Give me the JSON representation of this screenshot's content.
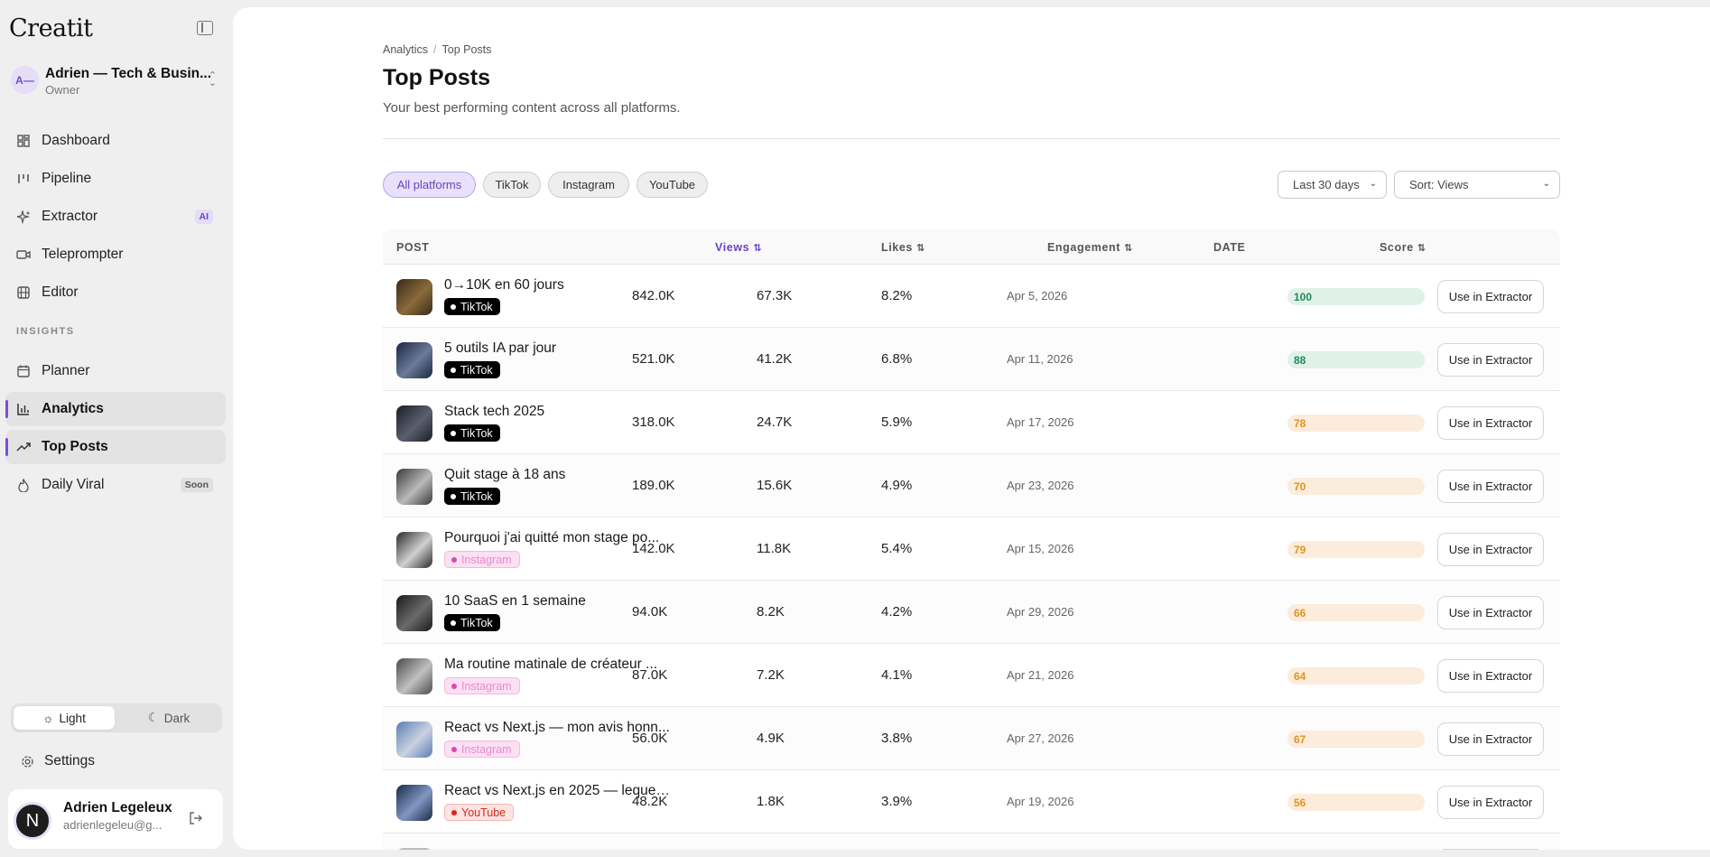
{
  "app": {
    "logo": "Creatit",
    "workspace": {
      "avatar": "A—",
      "name": "Adrien — Tech & Busin...",
      "role": "Owner"
    }
  },
  "nav": {
    "items": [
      {
        "label": "Dashboard",
        "icon": "grid-icon"
      },
      {
        "label": "Pipeline",
        "icon": "kanban-icon"
      },
      {
        "label": "Extractor",
        "icon": "sparkles-icon",
        "badge": "AI"
      },
      {
        "label": "Teleprompter",
        "icon": "video-icon"
      },
      {
        "label": "Editor",
        "icon": "film-icon"
      }
    ],
    "section_label": "INSIGHTS",
    "insights": [
      {
        "label": "Planner",
        "icon": "calendar-icon"
      },
      {
        "label": "Analytics",
        "icon": "bar-chart-icon",
        "active": true
      },
      {
        "label": "Top Posts",
        "icon": "trending-up-icon",
        "active": true
      },
      {
        "label": "Daily Viral",
        "icon": "flame-icon",
        "badge": "Soon"
      }
    ]
  },
  "theme": {
    "light": "Light",
    "dark": "Dark",
    "selected": "Light"
  },
  "settings_label": "Settings",
  "user": {
    "avatar": "N",
    "name": "Adrien Legeleux",
    "email": "adrienlegeleu@g..."
  },
  "page": {
    "breadcrumb": [
      "Analytics",
      "Top Posts"
    ],
    "title": "Top Posts",
    "subtitle": "Your best performing content across all platforms."
  },
  "filters": {
    "platforms": [
      "All platforms",
      "TikTok",
      "Instagram",
      "YouTube"
    ],
    "active_platform": "All platforms",
    "range": "Last 30 days",
    "sort": "Sort: Views"
  },
  "table": {
    "columns": [
      "POST",
      "Views",
      "Likes",
      "Engagement",
      "DATE",
      "Score"
    ],
    "sort_icon": "⇅",
    "action_label": "Use in Extractor",
    "rows": [
      {
        "title": "0→10K en 60 jours",
        "platform": "TikTok",
        "views": "842.0K",
        "likes": "67.3K",
        "engagement": "8.2%",
        "date": "Apr 5, 2026",
        "score": "100",
        "score_level": "green",
        "thumb": [
          "#3a2a1a",
          "#8a6a3a"
        ]
      },
      {
        "title": "5 outils IA par jour",
        "platform": "TikTok",
        "views": "521.0K",
        "likes": "41.2K",
        "engagement": "6.8%",
        "date": "Apr 11, 2026",
        "score": "88",
        "score_level": "green",
        "thumb": [
          "#1b2740",
          "#6a7a99"
        ]
      },
      {
        "title": "Stack tech 2025",
        "platform": "TikTok",
        "views": "318.0K",
        "likes": "24.7K",
        "engagement": "5.9%",
        "date": "Apr 17, 2026",
        "score": "78",
        "score_level": "orange",
        "thumb": [
          "#1c1c24",
          "#5a5f70"
        ]
      },
      {
        "title": "Quit stage à 18 ans",
        "platform": "TikTok",
        "views": "189.0K",
        "likes": "15.6K",
        "engagement": "4.9%",
        "date": "Apr 23, 2026",
        "score": "70",
        "score_level": "orange",
        "thumb": [
          "#3a3a3a",
          "#b9b9b9"
        ]
      },
      {
        "title": "Pourquoi j'ai quitté mon stage po...",
        "platform": "Instagram",
        "views": "142.0K",
        "likes": "11.8K",
        "engagement": "5.4%",
        "date": "Apr 15, 2026",
        "score": "79",
        "score_level": "orange",
        "thumb": [
          "#2a2a2a",
          "#d0d0d0"
        ]
      },
      {
        "title": "10 SaaS en 1 semaine",
        "platform": "TikTok",
        "views": "94.0K",
        "likes": "8.2K",
        "engagement": "4.2%",
        "date": "Apr 29, 2026",
        "score": "66",
        "score_level": "orange",
        "thumb": [
          "#1a1a1a",
          "#6a6a6a"
        ]
      },
      {
        "title": "Ma routine matinale de créateur ...",
        "platform": "Instagram",
        "views": "87.0K",
        "likes": "7.2K",
        "engagement": "4.1%",
        "date": "Apr 21, 2026",
        "score": "64",
        "score_level": "orange",
        "thumb": [
          "#4a4a4a",
          "#c0c0c0"
        ]
      },
      {
        "title": "React vs Next.js — mon avis honn...",
        "platform": "Instagram",
        "views": "56.0K",
        "likes": "4.9K",
        "engagement": "3.8%",
        "date": "Apr 27, 2026",
        "score": "67",
        "score_level": "orange",
        "thumb": [
          "#5b7db5",
          "#c9d2e0"
        ]
      },
      {
        "title": "React vs Next.js en 2025 — lequel ...",
        "platform": "YouTube",
        "views": "48.2K",
        "likes": "1.8K",
        "engagement": "3.9%",
        "date": "Apr 19, 2026",
        "score": "56",
        "score_level": "orange",
        "thumb": [
          "#1c2a48",
          "#8097c0"
        ]
      }
    ]
  },
  "colors": {
    "accent": "#6a42c6",
    "green": "#1f8a5a",
    "orange": "#e09322"
  }
}
